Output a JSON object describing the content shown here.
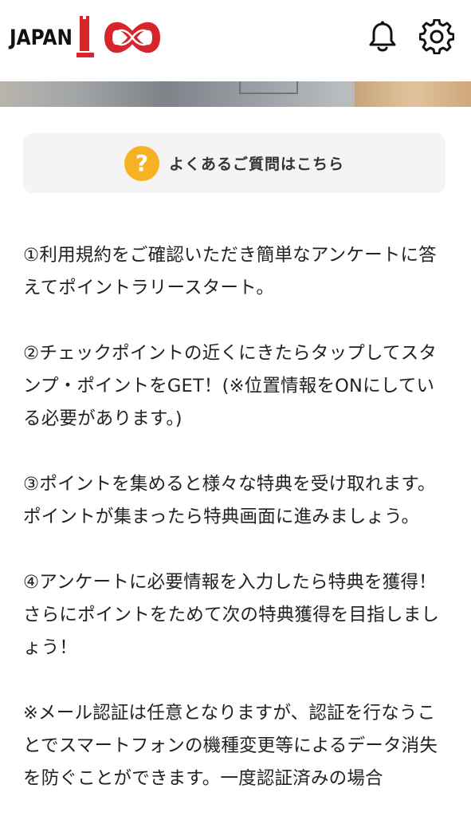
{
  "header": {
    "logo_text": "JAPAN",
    "logo_number": "100",
    "bell_icon": "bell-icon",
    "settings_icon": "gear-icon"
  },
  "colors": {
    "brand_red": "#d6262b",
    "faq_icon": "#f6b223",
    "faq_bg": "#f4f4f4"
  },
  "faq": {
    "icon": "question-icon",
    "icon_glyph": "?",
    "label": "よくあるご質問はこちら"
  },
  "content": {
    "paragraphs": [
      "①利用規約をご確認いただき簡単なアンケートに答えてポイントラリースタート。",
      "②チェックポイントの近くにきたらタップしてスタンプ・ポイントをGET！(※位置情報をONにしている必要があります。)",
      "③ポイントを集めると様々な特典を受け取れます。ポイントが集まったら特典画面に進みましょう。",
      "④アンケートに必要情報を入力したら特典を獲得！さらにポイントをためて次の特典獲得を目指しましょう！",
      "※メール認証は任意となりますが、認証を行なうことでスマートフォンの機種変更等によるデータ消失を防ぐことができます。一度認証済みの場合"
    ]
  }
}
